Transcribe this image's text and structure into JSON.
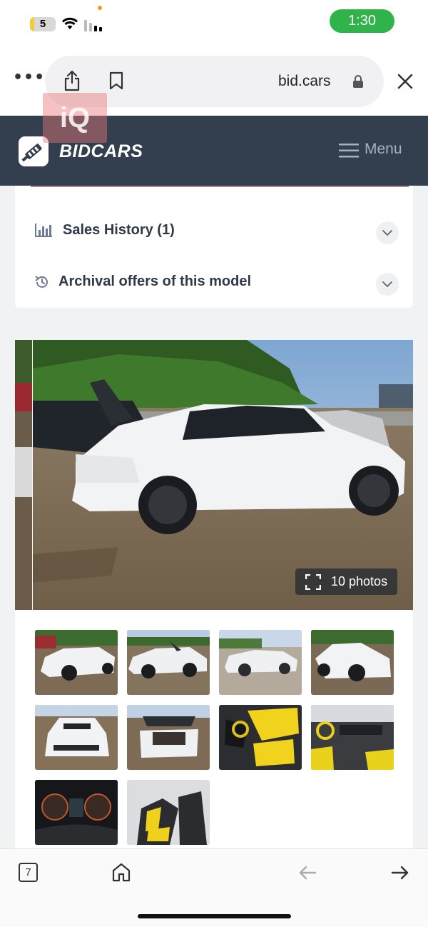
{
  "status_bar": {
    "signal_badge": "5",
    "time": "1:30"
  },
  "browser": {
    "url": "bid.cars",
    "icons": [
      "more-icon",
      "share-icon",
      "bookmark-icon",
      "lock-icon",
      "close-icon"
    ]
  },
  "site_header": {
    "logo_text": "BIDCARS",
    "menu_label": "Menu",
    "background_color": "#333f4e"
  },
  "watermark": "iQ",
  "accordion": {
    "items": [
      {
        "label": "Sales History (1)",
        "icon": "bar-chart-icon"
      },
      {
        "label": "Archival offers of this model",
        "icon": "history-icon"
      }
    ]
  },
  "gallery": {
    "photo_count_label": "10 photos",
    "thumbnails": [
      {
        "caption": "front-left exterior"
      },
      {
        "caption": "left side exterior"
      },
      {
        "caption": "rear-left exterior"
      },
      {
        "caption": "front-right exterior"
      },
      {
        "caption": "front exterior"
      },
      {
        "caption": "rear open trunk"
      },
      {
        "caption": "driver seat interior"
      },
      {
        "caption": "dashboard interior"
      },
      {
        "caption": "instrument cluster"
      },
      {
        "caption": "rear seat interior"
      }
    ]
  },
  "bottom_toolbar": {
    "tab_count": "7",
    "icons": [
      "tabs-icon",
      "home-icon",
      "back-arrow-icon",
      "forward-arrow-icon"
    ]
  }
}
